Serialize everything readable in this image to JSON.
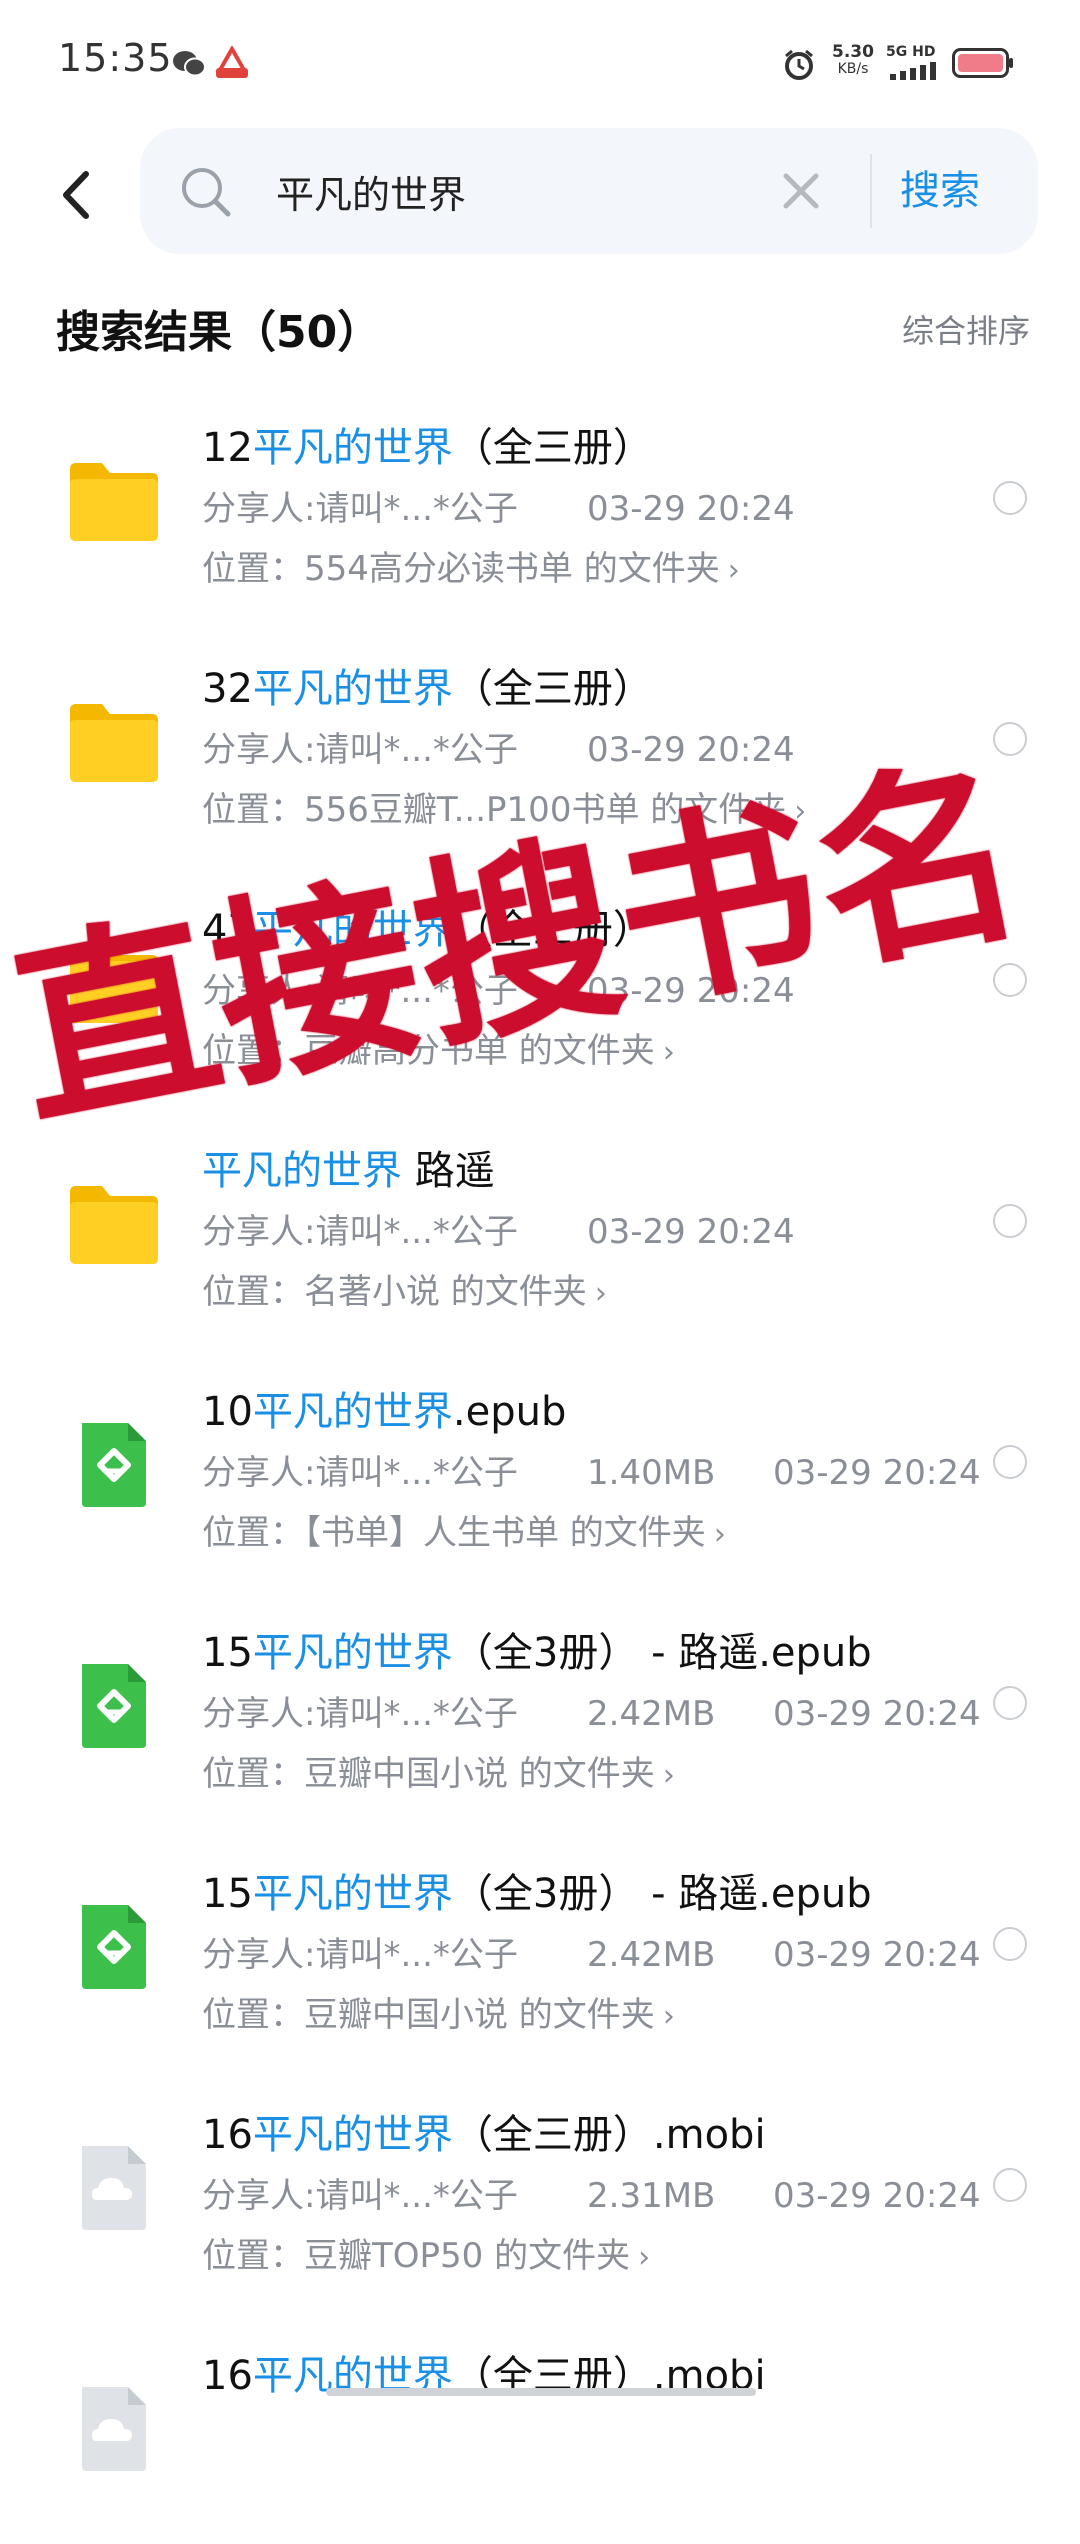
{
  "status_bar": {
    "time": "15:35",
    "net_speed_value": "5.30",
    "net_speed_unit": "KB/s",
    "network_label": "5G HD",
    "icons": [
      "wechat-icon",
      "app-notification-icon",
      "alarm-icon",
      "signal-icon",
      "battery-icon"
    ]
  },
  "search": {
    "query": "平凡的世界",
    "button_label": "搜索"
  },
  "results": {
    "title": "搜索结果（50）",
    "sort_label": "综合排序",
    "items": [
      {
        "icon": "folder-icon",
        "prefix": "12",
        "highlight": "平凡的世界",
        "suffix": "（全三册）",
        "sharer": "分享人:请叫*...*公子",
        "size": "",
        "date": "03-29 20:24",
        "location": "位置：554高分必读书单 的文件夹"
      },
      {
        "icon": "folder-icon",
        "prefix": "32",
        "highlight": "平凡的世界",
        "suffix": "（全三册）",
        "sharer": "分享人:请叫*...*公子",
        "size": "",
        "date": "03-29 20:24",
        "location": "位置：556豆瓣T...P100书单 的文件夹"
      },
      {
        "icon": "folder-icon",
        "prefix": "47",
        "highlight": "平凡的世界",
        "suffix": "（全三册）",
        "sharer": "分享人:请叫*...*公子",
        "size": "",
        "date": "03-29 20:24",
        "location": "位置：豆瓣高分书单 的文件夹"
      },
      {
        "icon": "folder-icon",
        "prefix": "",
        "highlight": "平凡的世界",
        "suffix": " 路遥",
        "sharer": "分享人:请叫*...*公子",
        "size": "",
        "date": "03-29 20:24",
        "location": "位置：名著小说 的文件夹"
      },
      {
        "icon": "epub-icon",
        "prefix": "10",
        "highlight": "平凡的世界",
        "suffix": ".epub",
        "sharer": "分享人:请叫*...*公子",
        "size": "1.40MB",
        "date": "03-29 20:24",
        "location": "位置：【书单】人生书单 的文件夹"
      },
      {
        "icon": "epub-icon",
        "prefix": "15",
        "highlight": "平凡的世界",
        "suffix": "（全3册） - 路遥.epub",
        "sharer": "分享人:请叫*...*公子",
        "size": "2.42MB",
        "date": "03-29 20:24",
        "location": "位置：豆瓣中国小说 的文件夹"
      },
      {
        "icon": "epub-icon",
        "prefix": "15",
        "highlight": "平凡的世界",
        "suffix": "（全3册） - 路遥.epub",
        "sharer": "分享人:请叫*...*公子",
        "size": "2.42MB",
        "date": "03-29 20:24",
        "location": "位置：豆瓣中国小说 的文件夹"
      },
      {
        "icon": "cloud-file-icon",
        "prefix": "16",
        "highlight": "平凡的世界",
        "suffix": "（全三册）.mobi",
        "sharer": "分享人:请叫*...*公子",
        "size": "2.31MB",
        "date": "03-29 20:24",
        "location": "位置：豆瓣TOP50 的文件夹"
      },
      {
        "icon": "cloud-file-icon",
        "prefix": "16",
        "highlight": "平凡的世界",
        "suffix": "（全三册）.mobi",
        "sharer": "",
        "size": "",
        "date": "",
        "location": ""
      }
    ]
  },
  "overlay": {
    "text": "直接搜书名",
    "color": "#cc0d2d"
  },
  "colors": {
    "accent": "#1a8fe6",
    "folder": "#ffc61a",
    "epub": "#3cc04b"
  }
}
